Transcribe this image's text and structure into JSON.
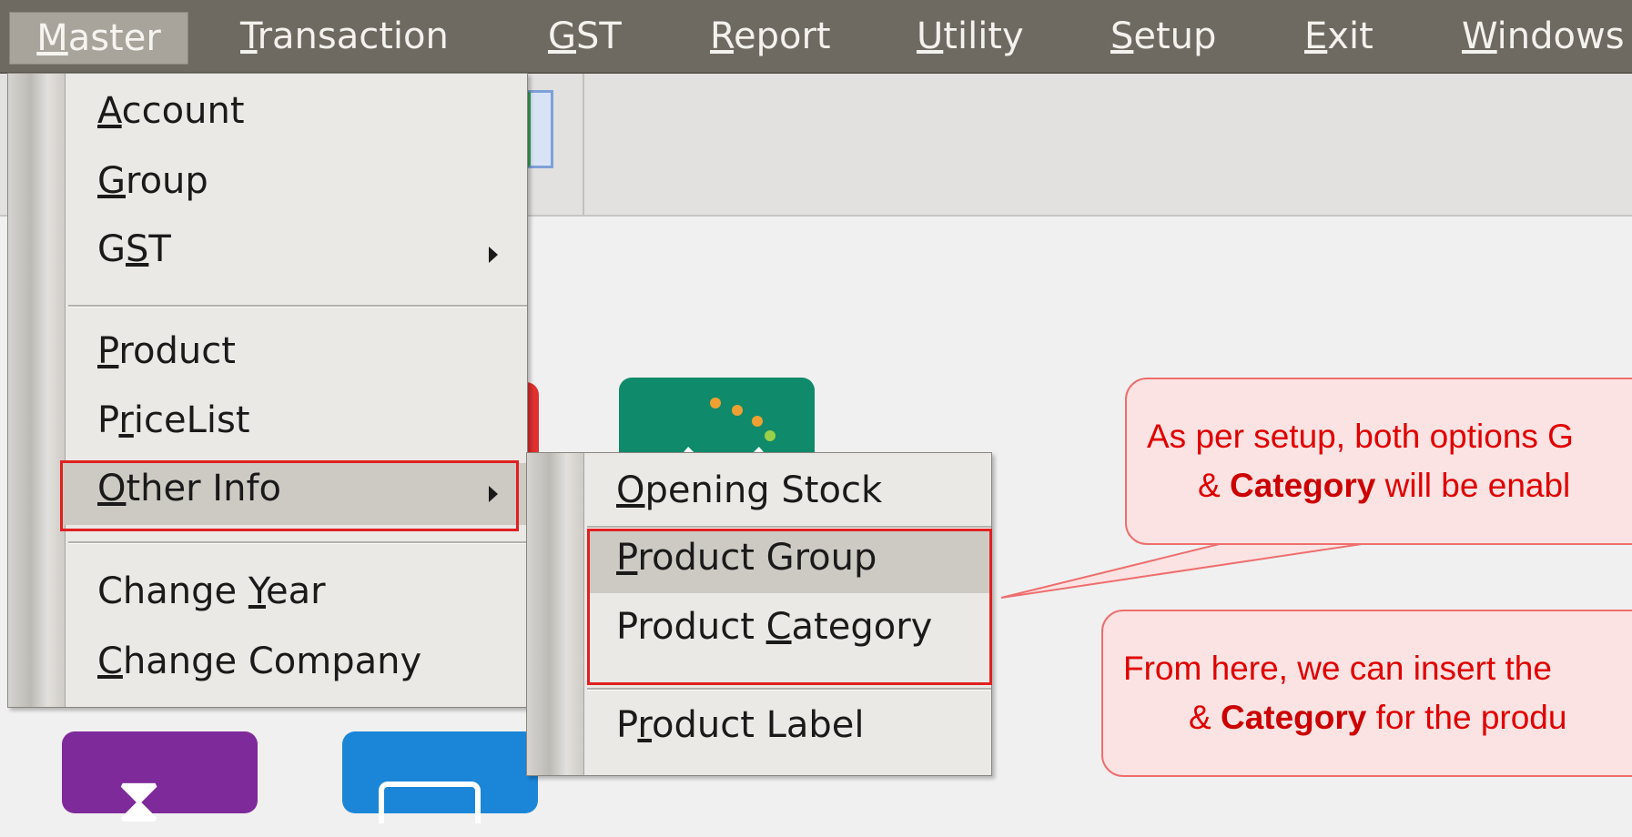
{
  "menubar": {
    "items": [
      {
        "pre": "",
        "u": "M",
        "post": "aster"
      },
      {
        "pre": "",
        "u": "T",
        "post": "ransaction"
      },
      {
        "pre": "",
        "u": "G",
        "post": "ST"
      },
      {
        "pre": "",
        "u": "R",
        "post": "eport"
      },
      {
        "pre": "",
        "u": "U",
        "post": "tility"
      },
      {
        "pre": "",
        "u": "S",
        "post": "etup"
      },
      {
        "pre": "",
        "u": "E",
        "post": "xit"
      },
      {
        "pre": "",
        "u": "W",
        "post": "indows"
      }
    ]
  },
  "master_menu": {
    "items": [
      {
        "pre": "",
        "u": "A",
        "post": "ccount"
      },
      {
        "pre": "",
        "u": "G",
        "post": "roup"
      },
      {
        "pre": "G",
        "u": "S",
        "post": "T"
      },
      {
        "pre": "",
        "u": "P",
        "post": "roduct"
      },
      {
        "pre": "P",
        "u": "r",
        "post": "iceList"
      },
      {
        "pre": "",
        "u": "O",
        "post": "ther Info"
      },
      {
        "pre": "Change ",
        "u": "Y",
        "post": "ear"
      },
      {
        "pre": "",
        "u": "C",
        "post": "hange Company"
      }
    ]
  },
  "other_info_menu": {
    "items": [
      {
        "pre": "",
        "u": "O",
        "post": "pening Stock"
      },
      {
        "pre": "",
        "u": "P",
        "post": "roduct Group"
      },
      {
        "pre": "Product ",
        "u": "C",
        "post": "ategory"
      },
      {
        "pre": "P",
        "u": "r",
        "post": "oduct Label"
      }
    ]
  },
  "callouts": {
    "first": {
      "line1": "As per setup, both options G",
      "line2_pre": "& ",
      "line2_bold": "Category",
      "line2_post": " will be enabl"
    },
    "second": {
      "line1": "From here, we can insert the",
      "line2_pre": "& ",
      "line2_bold": "Category",
      "line2_post": " for the produ"
    }
  },
  "colors": {
    "menubar_bg": "#6e6961",
    "highlight_box": "#e02020",
    "callout_text": "#e00000",
    "callout_bg": "#fbe3e3"
  }
}
